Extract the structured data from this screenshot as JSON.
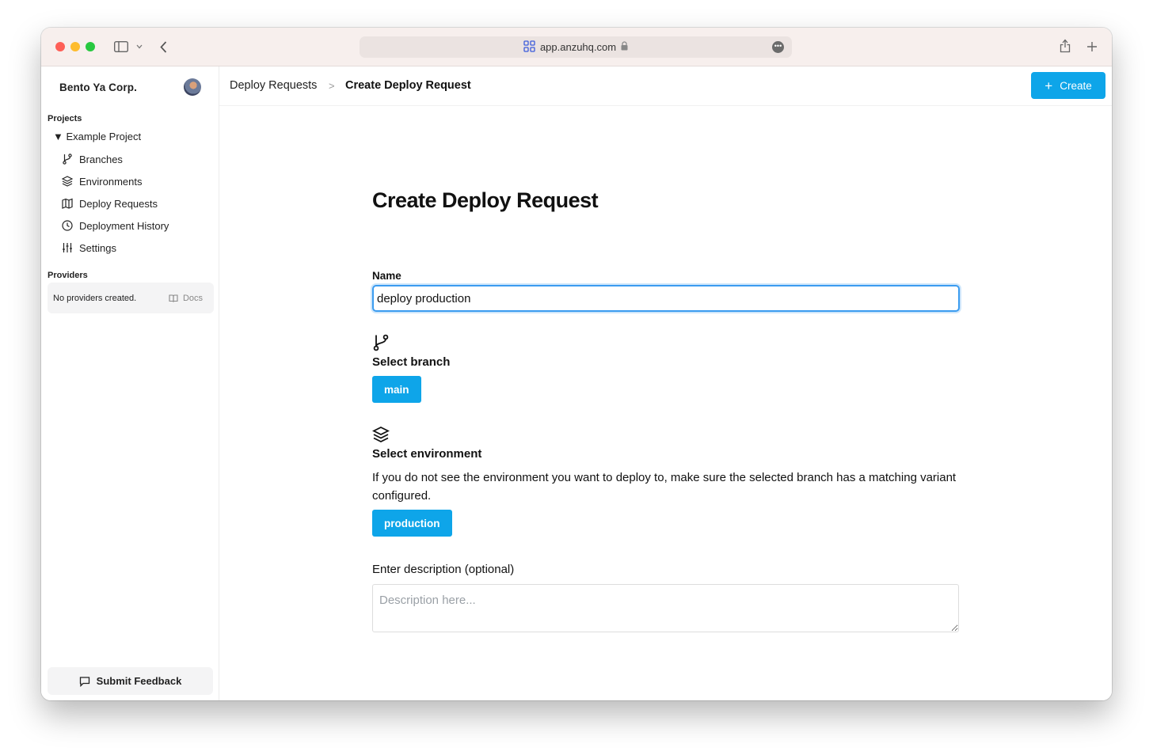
{
  "browser": {
    "url": "app.anzuhq.com"
  },
  "sidebar": {
    "org_name": "Bento Ya Corp.",
    "projects_label": "Projects",
    "project_name": "▼ Example Project",
    "items": [
      {
        "label": "Branches",
        "icon": "git-branch-icon"
      },
      {
        "label": "Environments",
        "icon": "layers-icon"
      },
      {
        "label": "Deploy Requests",
        "icon": "map-icon"
      },
      {
        "label": "Deployment History",
        "icon": "clock-icon"
      },
      {
        "label": "Settings",
        "icon": "sliders-icon"
      }
    ],
    "providers_label": "Providers",
    "no_providers": "No providers created.",
    "docs_label": "Docs",
    "feedback_label": "Submit Feedback"
  },
  "header": {
    "breadcrumb_parent": "Deploy Requests",
    "breadcrumb_separator": ">",
    "breadcrumb_current": "Create Deploy Request",
    "create_label": "Create"
  },
  "form": {
    "title": "Create Deploy Request",
    "name_label": "Name",
    "name_value": "deploy production",
    "branch_label": "Select branch",
    "branch_value": "main",
    "environment_label": "Select environment",
    "environment_help": "If you do not see the environment you want to deploy to, make sure the selected branch has a matching variant configured.",
    "environment_value": "production",
    "description_label": "Enter description (optional)",
    "description_placeholder": "Description here..."
  },
  "colors": {
    "accent": "#0ea5e9",
    "focus_ring": "#3b9cf0"
  }
}
